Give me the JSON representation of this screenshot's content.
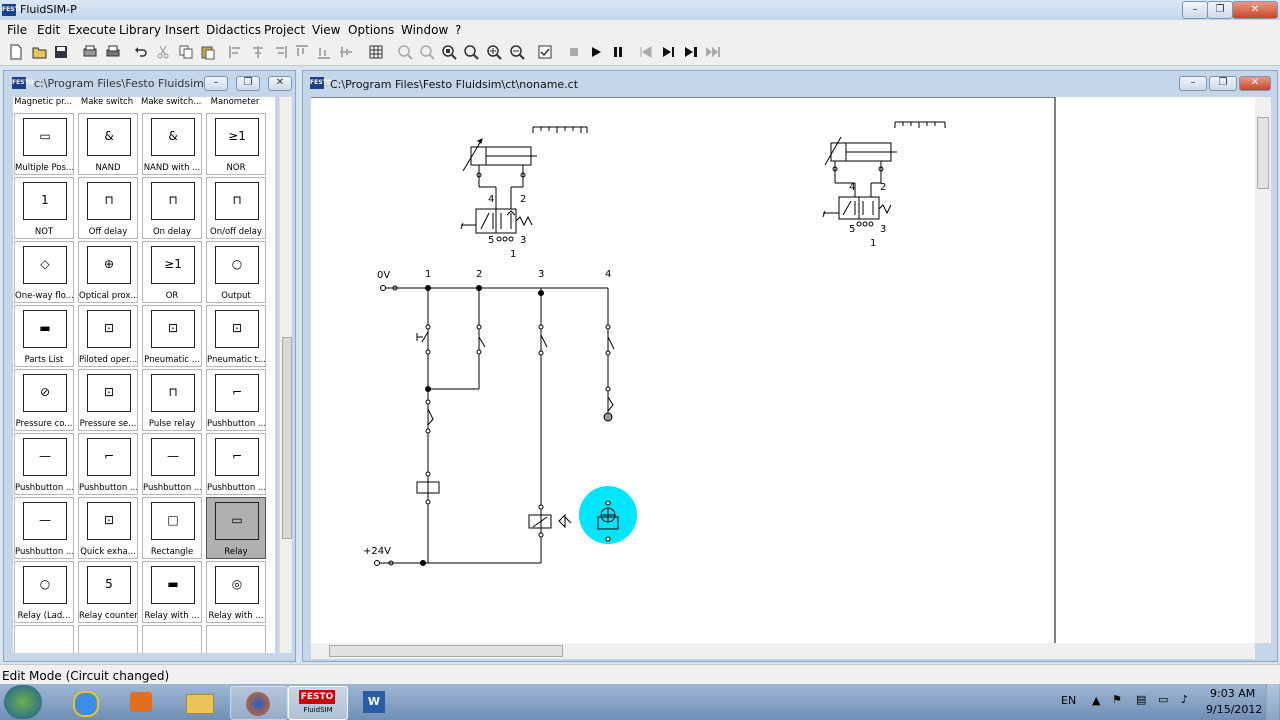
{
  "app": {
    "title": "FluidSIM-P",
    "icon_text": "FESTO"
  },
  "menu": [
    "File",
    "Edit",
    "Execute",
    "Library",
    "Insert",
    "Didactics",
    "Project",
    "View",
    "Options",
    "Window",
    "?"
  ],
  "library_window": {
    "title": "c:\\Program Files\\Festo Fluidsim...",
    "top_row": [
      "Magnetic pr...",
      "Make switch",
      "Make switch...",
      "Manometer"
    ],
    "items": [
      "Multiple Pos...",
      "NAND",
      "NAND with ...",
      "NOR",
      "NOT",
      "Off delay",
      "On delay",
      "On/off delay",
      "One-way flo...",
      "Optical prox...",
      "OR",
      "Output",
      "Parts List",
      "Piloted oper...",
      "Pneumatic ...",
      "Pneumatic t...",
      "Pressure co...",
      "Pressure se...",
      "Pulse relay",
      "Pushbutton ...",
      "Pushbutton ...",
      "Pushbutton ...",
      "Pushbutton ...",
      "Pushbutton ...",
      "Pushbutton ...",
      "Quick exha...",
      "Rectangle",
      "Relay",
      "Relay (Lad...",
      "Relay counter",
      "Relay with ...",
      "Relay with ...",
      "",
      "",
      "",
      ""
    ],
    "selected_item": "Relay"
  },
  "circuit_window": {
    "title": "C:\\Program Files\\Festo Fluidsim\\ct\\noname.ct",
    "labels": {
      "v0": "0V",
      "v24": "+24V",
      "col1": "1",
      "col2": "2",
      "col3": "3",
      "col4": "4",
      "valve1_port4": "4",
      "valve1_port2": "2",
      "valve1_port5": "5",
      "valve1_port3": "3",
      "valve1_port1": "1",
      "valve2_port4": "4",
      "valve2_port2": "2",
      "valve2_port5": "5",
      "valve2_port3": "3",
      "valve2_port1": "1"
    }
  },
  "status": "Edit Mode (Circuit changed)",
  "taskbar": {
    "festo_label": "FESTO",
    "festo_sub": "FluidSIM",
    "language": "EN",
    "time": "9:03 AM",
    "date": "9/15/2012"
  },
  "colors": {
    "highlight": "#00e5ff",
    "selection": "#b0b0b0"
  }
}
